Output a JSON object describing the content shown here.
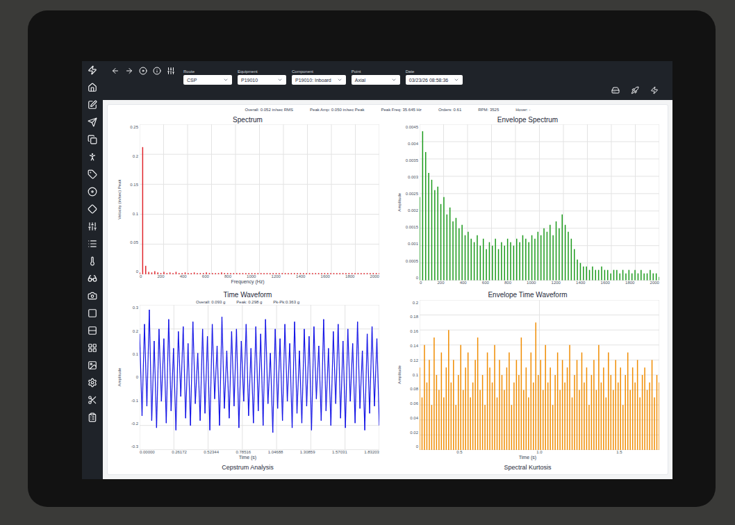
{
  "toolbar": {
    "fields": [
      {
        "label": "Route",
        "value": "CSP"
      },
      {
        "label": "Equipment",
        "value": "P19010"
      },
      {
        "label": "Component",
        "value": "P19010: Inboard"
      },
      {
        "label": "Point",
        "value": "Axial"
      },
      {
        "label": "Date",
        "value": "03/23/26 08:58:36"
      }
    ]
  },
  "summary": [
    "Overall: 0.052 in/sec RMS",
    "Peak Amp: 0.050 in/sec Peak",
    "Peak Freq: 35.645 Hz",
    "Orders: 0.61",
    "RPM: 3525",
    "Hover: -"
  ],
  "charts": [
    {
      "title": "Spectrum",
      "kind": "sticks",
      "color": "#e0242b",
      "header": [],
      "y_label": "Velocity (in/sec) Peak",
      "y_ticks": [
        "0.25",
        "0.2",
        "0.15",
        "0.1",
        "0.05",
        "0"
      ],
      "x_label": "Frequency (Hz)",
      "x_ticks": [
        "0",
        "200",
        "400",
        "600",
        "800",
        "1000",
        "1200",
        "1400",
        "1600",
        "1800",
        "2000"
      ],
      "values": [
        0.003,
        0.212,
        0.014,
        0.004,
        0.003,
        0.005,
        0.003,
        0.002,
        0.004,
        0.002,
        0.003,
        0.002,
        0.004,
        0.002,
        0.002,
        0.003,
        0.002,
        0.002,
        0.003,
        0.002,
        0.002,
        0.002,
        0.003,
        0.002,
        0.002,
        0.002,
        0.002,
        0.003,
        0.002,
        0.002,
        0.002,
        0.002,
        0.002,
        0.002,
        0.002,
        0.002,
        0.002,
        0.002,
        0.002,
        0.002,
        0.002,
        0.002,
        0.002,
        0.002,
        0.002,
        0.002,
        0.002,
        0.002,
        0.002,
        0.002,
        0.002,
        0.002,
        0.002,
        0.002,
        0.002,
        0.002,
        0.002,
        0.002,
        0.002,
        0.002,
        0.002,
        0.002,
        0.002,
        0.002,
        0.002,
        0.002,
        0.002,
        0.002,
        0.002,
        0.002,
        0.002,
        0.002,
        0.002,
        0.002,
        0.002,
        0.002,
        0.002,
        0.002,
        0.002,
        0.002
      ]
    },
    {
      "title": "Envelope Spectrum",
      "kind": "sticks",
      "color": "#1a9a1a",
      "header": [],
      "y_label": "Amplitude",
      "y_ticks": [
        "0.0045",
        "0.004",
        "0.0035",
        "0.003",
        "0.0025",
        "0.002",
        "0.0015",
        "0.001",
        "0.0005",
        "0"
      ],
      "x_label": "",
      "x_ticks": [
        "0",
        "200",
        "400",
        "600",
        "800",
        "1000",
        "1200",
        "1400",
        "1600",
        "1800",
        "2000"
      ],
      "values": [
        0.0024,
        0.0043,
        0.0037,
        0.0031,
        0.0029,
        0.0026,
        0.0027,
        0.0022,
        0.0024,
        0.0019,
        0.0021,
        0.0017,
        0.0018,
        0.0015,
        0.0016,
        0.0013,
        0.0014,
        0.0012,
        0.0011,
        0.0013,
        0.001,
        0.0012,
        0.0009,
        0.0011,
        0.001,
        0.0012,
        0.0009,
        0.0011,
        0.001,
        0.0012,
        0.0011,
        0.001,
        0.0012,
        0.0011,
        0.0013,
        0.0012,
        0.0011,
        0.0013,
        0.0012,
        0.0014,
        0.0013,
        0.0015,
        0.0014,
        0.0016,
        0.0013,
        0.0017,
        0.0015,
        0.0019,
        0.0016,
        0.0014,
        0.0012,
        0.0009,
        0.0006,
        0.0005,
        0.0004,
        0.0004,
        0.0003,
        0.0004,
        0.0003,
        0.0003,
        0.0004,
        0.0003,
        0.0003,
        0.0002,
        0.0003,
        0.0003,
        0.0002,
        0.0003,
        0.0002,
        0.0003,
        0.0002,
        0.0003,
        0.0002,
        0.0003,
        0.0002,
        0.0002,
        0.0003,
        0.0002,
        0.0002,
        0.0001
      ]
    },
    {
      "title": "Time Waveform",
      "kind": "line",
      "color": "#1414e6",
      "header": [
        "Overall: 0.093 g",
        "Peak: 0.298 g",
        "Pk-Pk:0.363 g"
      ],
      "y_label": "Amplitude",
      "y_ticks": [
        "0.3",
        "0.2",
        "0.1",
        "0",
        "-0.1",
        "-0.2",
        "-0.3"
      ],
      "x_label": "Time (s)",
      "x_ticks": [
        "0.00000",
        "0.26172",
        "0.52344",
        "0.78516",
        "1.04688",
        "1.30859",
        "1.57031",
        "1.83203"
      ],
      "values": [
        0.18,
        -0.16,
        0.22,
        -0.12,
        0.28,
        -0.18,
        0.15,
        -0.21,
        0.2,
        -0.1,
        0.16,
        -0.19,
        0.24,
        -0.14,
        0.12,
        -0.22,
        0.19,
        -0.08,
        0.21,
        -0.17,
        0.14,
        -0.2,
        0.23,
        -0.11,
        0.1,
        -0.18,
        0.2,
        -0.15,
        0.17,
        -0.22,
        0.22,
        -0.09,
        0.13,
        -0.2,
        0.25,
        -0.13,
        0.11,
        -0.17,
        0.19,
        -0.12,
        0.2,
        -0.21,
        0.15,
        -0.1,
        0.22,
        -0.16,
        0.12,
        -0.19,
        0.21,
        -0.14,
        0.18,
        -0.2,
        0.24,
        -0.11,
        0.1,
        -0.23,
        0.2,
        -0.13,
        0.16,
        -0.18,
        0.22,
        -0.1,
        0.14,
        -0.21,
        0.23,
        -0.15,
        0.11,
        -0.19,
        0.2,
        -0.12,
        0.17,
        -0.22,
        0.21,
        -0.09,
        0.13,
        -0.18,
        0.24,
        -0.14,
        0.12,
        -0.2,
        0.19,
        -0.11,
        0.22,
        -0.17,
        0.15,
        -0.21,
        0.2,
        -0.1,
        0.14,
        -0.19,
        0.23,
        -0.13,
        0.11,
        -0.22,
        0.18,
        -0.15,
        0.21,
        -0.12,
        0.16,
        -0.2
      ]
    },
    {
      "title": "Envelope Time Waveform",
      "kind": "sticks",
      "color": "#f08c00",
      "header": [],
      "y_label": "Amplitude",
      "y_ticks": [
        "0.2",
        "0.18",
        "0.16",
        "0.14",
        "0.12",
        "0.1",
        "0.08",
        "0.06",
        "0.04",
        "0.02",
        "0"
      ],
      "x_label": "Time (s)",
      "x_ticks": [
        "0.5",
        "1.0",
        "1.5"
      ],
      "values": [
        0.11,
        0.07,
        0.14,
        0.09,
        0.12,
        0.06,
        0.15,
        0.1,
        0.08,
        0.13,
        0.07,
        0.11,
        0.16,
        0.09,
        0.12,
        0.06,
        0.1,
        0.14,
        0.08,
        0.11,
        0.13,
        0.07,
        0.09,
        0.12,
        0.15,
        0.08,
        0.1,
        0.06,
        0.13,
        0.11,
        0.09,
        0.14,
        0.07,
        0.12,
        0.1,
        0.08,
        0.11,
        0.13,
        0.06,
        0.09,
        0.12,
        0.1,
        0.15,
        0.08,
        0.11,
        0.07,
        0.13,
        0.09,
        0.17,
        0.1,
        0.12,
        0.08,
        0.14,
        0.09,
        0.11,
        0.06,
        0.1,
        0.13,
        0.08,
        0.12,
        0.09,
        0.11,
        0.14,
        0.07,
        0.1,
        0.12,
        0.08,
        0.13,
        0.09,
        0.11,
        0.06,
        0.1,
        0.12,
        0.08,
        0.14,
        0.09,
        0.11,
        0.07,
        0.13,
        0.1,
        0.08,
        0.12,
        0.09,
        0.11,
        0.06,
        0.1,
        0.13,
        0.08,
        0.11,
        0.09,
        0.12,
        0.07,
        0.1,
        0.11,
        0.08,
        0.09,
        0.12,
        0.07,
        0.1,
        0.09
      ]
    }
  ],
  "sections": [
    "Cepstrum Analysis",
    "Spectral Kurtosis"
  ]
}
